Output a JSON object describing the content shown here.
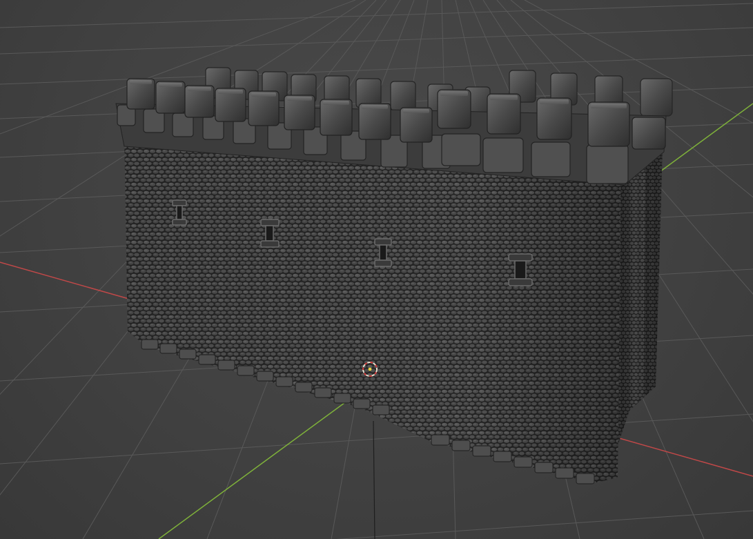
{
  "app": {
    "name": "3D viewport",
    "view": "perspective"
  },
  "colors": {
    "background": "#414141",
    "grid_line": "#5a5a5a",
    "x_axis": "#c64a4a",
    "y_axis": "#7fb23a",
    "stone_dark": "#2c2c2c",
    "stone_light": "#5c5c5c",
    "wall_face": "#3a3a3a",
    "cursor_ring": "#e8e0d0",
    "cursor_accent": "#d43c3c"
  },
  "scene": {
    "object": "castle-wall-with-battlements",
    "material": "cobblestone",
    "grid_visible": true,
    "x_axis_visible": true,
    "y_axis_visible": true,
    "merlons_back_row": 13,
    "merlons_front_row": 14,
    "arrow_slits": 4
  },
  "icons": {
    "cursor": "3d-cursor-icon",
    "arrow_slit": "arrow-slit-icon"
  }
}
